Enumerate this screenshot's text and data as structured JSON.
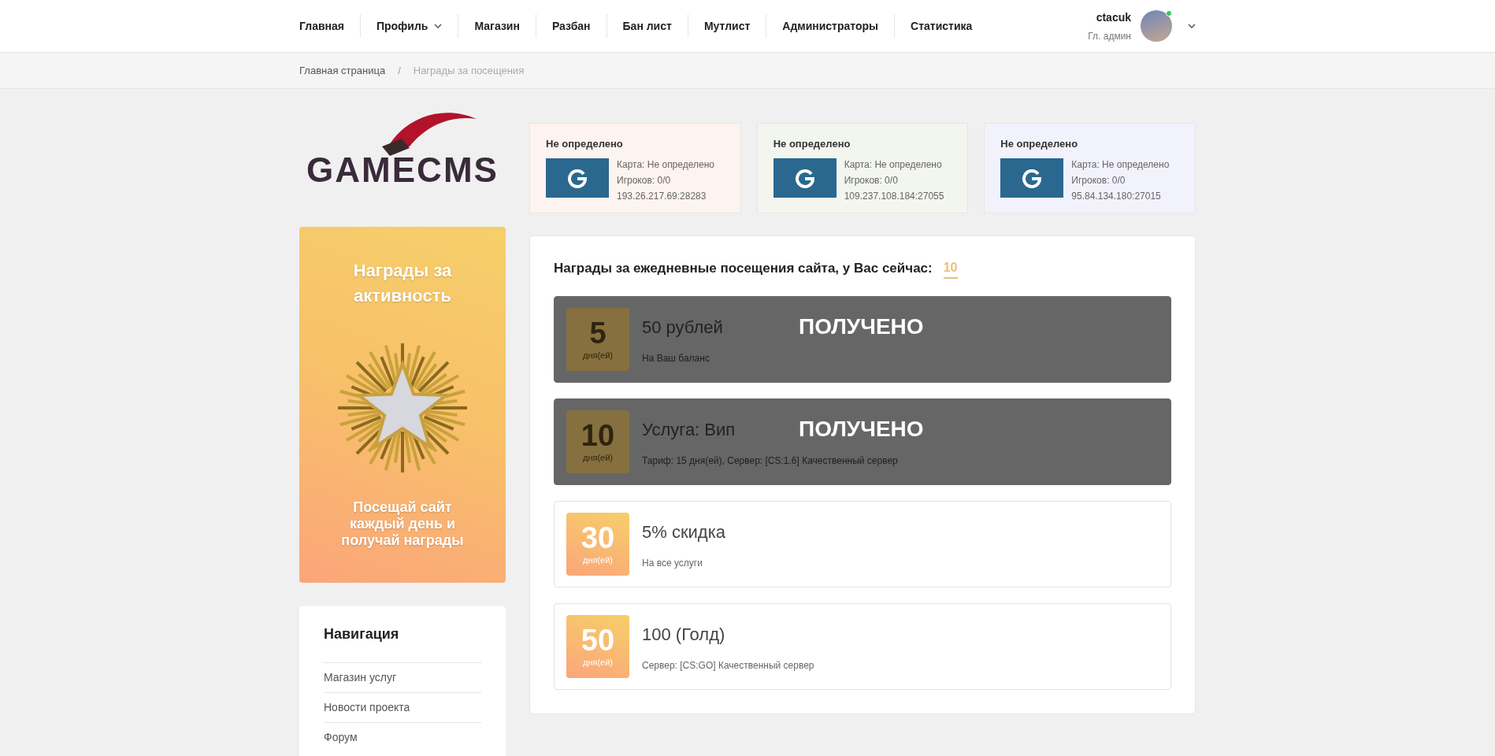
{
  "nav": {
    "items": [
      {
        "label": "Главная",
        "dropdown": false
      },
      {
        "label": "Профиль",
        "dropdown": true
      },
      {
        "label": "Магазин",
        "dropdown": false
      },
      {
        "label": "Разбан",
        "dropdown": false
      },
      {
        "label": "Бан лист",
        "dropdown": false
      },
      {
        "label": "Мутлист",
        "dropdown": false
      },
      {
        "label": "Администраторы",
        "dropdown": false
      },
      {
        "label": "Статистика",
        "dropdown": false
      }
    ],
    "user": {
      "name": "ctacuk",
      "role": "Гл. админ",
      "online": true
    }
  },
  "breadcrumb": [
    "Главная страница",
    "Награды за посещения"
  ],
  "breadcrumb_separator": "/",
  "logo": {
    "text": "GAMECMS"
  },
  "servers": [
    {
      "name": "Не определено",
      "map": "Карта: Не определено",
      "players": "Игроков: 0/0",
      "address": "193.26.217.69:28283",
      "color": "#fdf3ef"
    },
    {
      "name": "Не определено",
      "map": "Карта: Не определено",
      "players": "Игроков: 0/0",
      "address": "109.237.108.184:27055",
      "color": "#f3f6ef"
    },
    {
      "name": "Не определено",
      "map": "Карта: Не определено",
      "players": "Игроков: 0/0",
      "address": "95.84.134.180:27015",
      "color": "#f2f2fd"
    }
  ],
  "banner": {
    "title": "Награды за активность",
    "subtitle": "Посещай сайт каждый день и получай награды"
  },
  "navigation": {
    "title": "Навигация",
    "items": [
      "Магазин услуг",
      "Новости проекта",
      "Форум"
    ]
  },
  "rewards": {
    "title": "Награды за ежедневные посещения сайта, у Вас сейчас:",
    "count": "10",
    "items": [
      {
        "days": "5",
        "unit": "дня(ей)",
        "name": "50 рублей",
        "description": "На Ваш баланс",
        "received": true,
        "status": "ПОЛУЧЕНО"
      },
      {
        "days": "10",
        "unit": "дня(ей)",
        "name": "Услуга: Вип",
        "description": "Тариф: 15 дня(ей), Сервер: [CS:1.6] Качественный сервер",
        "received": true,
        "status": "ПОЛУЧЕНО"
      },
      {
        "days": "30",
        "unit": "дня(ей)",
        "name": "5% скидка",
        "description": "На все услуги",
        "received": false
      },
      {
        "days": "50",
        "unit": "дня(ей)",
        "name": "100 (Голд)",
        "description": "Сервер: [CS:GO] Качественный сервер",
        "received": false
      }
    ]
  }
}
